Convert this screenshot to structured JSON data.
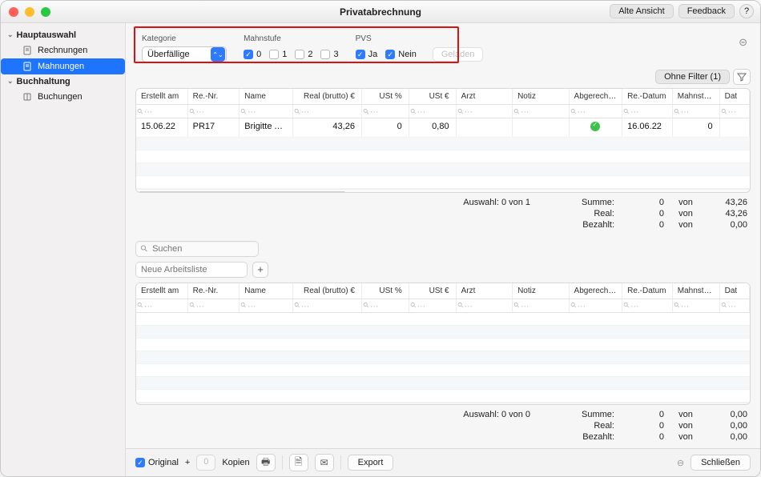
{
  "title": "Privatabrechnung",
  "titlebar_buttons": {
    "old_view": "Alte Ansicht",
    "feedback": "Feedback",
    "help": "?"
  },
  "sidebar": {
    "groups": [
      {
        "label": "Hauptauswahl",
        "items": [
          {
            "label": "Rechnungen",
            "icon": "doc-icon"
          },
          {
            "label": "Mahnungen",
            "icon": "doc-icon",
            "selected": true
          }
        ]
      },
      {
        "label": "Buchhaltung",
        "items": [
          {
            "label": "Buchungen",
            "icon": "book-icon"
          }
        ]
      }
    ]
  },
  "filters": {
    "kategorie": {
      "label": "Kategorie",
      "value": "Überfällige"
    },
    "mahnstufe": {
      "label": "Mahnstufe",
      "options": [
        {
          "label": "0",
          "checked": true
        },
        {
          "label": "1",
          "checked": false
        },
        {
          "label": "2",
          "checked": false
        },
        {
          "label": "3",
          "checked": false
        }
      ]
    },
    "pvs": {
      "label": "PVS",
      "options": [
        {
          "label": "Ja",
          "checked": true
        },
        {
          "label": "Nein",
          "checked": true
        }
      ]
    },
    "loaded_button": "Geladen"
  },
  "filterstrip": {
    "label": "Ohne Filter (1)"
  },
  "table_headers": [
    "Erstellt am",
    "Re.-Nr.",
    "Name",
    "Real (brutto) €",
    "USt %",
    "USt €",
    "Arzt",
    "Notiz",
    "Abgerechnet",
    "Re.-Datum",
    "Mahnstufe",
    "Dat"
  ],
  "rows": [
    {
      "erstellt": "15.06.22",
      "renr": "PR17",
      "name": "Brigitte Alt…",
      "real": "43,26",
      "ustp": "0",
      "uste": "0,80",
      "arzt": "",
      "notiz": "",
      "abgerechnet": true,
      "redatum": "16.06.22",
      "mahnstufe": "0",
      "dat": ""
    }
  ],
  "summary1": {
    "selection": "Auswahl:  0 von 1",
    "lines": [
      {
        "label": "Summe:",
        "a": "0",
        "von": "von",
        "b": "43,26"
      },
      {
        "label": "Real:",
        "a": "0",
        "von": "von",
        "b": "43,26"
      },
      {
        "label": "Bezahlt:",
        "a": "0",
        "von": "von",
        "b": "0,00"
      }
    ]
  },
  "search_placeholder": "Suchen",
  "worklist_placeholder": "Neue Arbeitsliste",
  "summary2": {
    "selection": "Auswahl:  0 von 0",
    "lines": [
      {
        "label": "Summe:",
        "a": "0",
        "von": "von",
        "b": "0,00"
      },
      {
        "label": "Real:",
        "a": "0",
        "von": "von",
        "b": "0,00"
      },
      {
        "label": "Bezahlt:",
        "a": "0",
        "von": "von",
        "b": "0,00"
      }
    ]
  },
  "bottombar": {
    "original": "Original",
    "kopien_value": "0",
    "kopien_label": "Kopien",
    "plus": "+",
    "export": "Export",
    "close": "Schließen"
  }
}
